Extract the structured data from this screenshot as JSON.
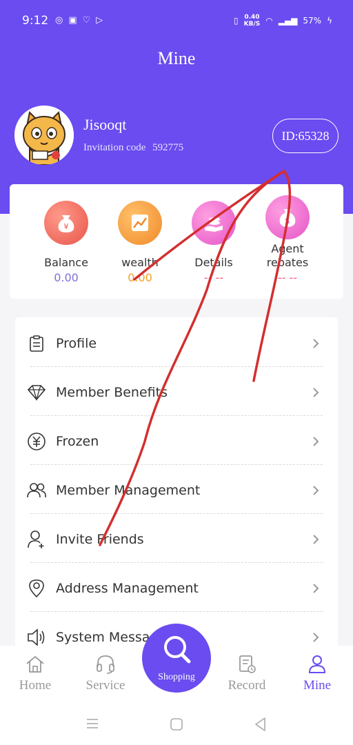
{
  "status_bar": {
    "time": "9:12",
    "net_speed_value": "0.40",
    "net_speed_unit": "KB/S",
    "battery": "57%"
  },
  "header": {
    "title": "Mine",
    "username": "Jisooqt",
    "invitation_label": "Invitation code",
    "invitation_code": "592775",
    "id_label": "ID:65328"
  },
  "stats": [
    {
      "label": "Balance",
      "value": "0.00",
      "color": "#7d6fd9",
      "icon": "money-bag-icon"
    },
    {
      "label": "wealth",
      "value": "0.00",
      "color": "#f0a020",
      "icon": "growth-chart-icon"
    },
    {
      "label": "Details",
      "value": "-- --",
      "color": "#f35c84",
      "icon": "hand-coin-icon"
    },
    {
      "label": "Agent\nrebates",
      "value": "-- --",
      "color": "#f35c84",
      "icon": "dollar-bag-icon"
    }
  ],
  "menu": [
    {
      "label": "Profile",
      "icon": "clipboard-icon"
    },
    {
      "label": "Member Benefits",
      "icon": "diamond-icon"
    },
    {
      "label": "Frozen",
      "icon": "yuan-circle-icon"
    },
    {
      "label": "Member Management",
      "icon": "users-icon"
    },
    {
      "label": "Invite Friends",
      "icon": "add-user-icon"
    },
    {
      "label": "Address Management",
      "icon": "location-pin-icon"
    },
    {
      "label": "System Messages",
      "icon": "speaker-icon"
    }
  ],
  "tabs": {
    "home": "Home",
    "service": "Service",
    "shopping": "Shopping",
    "record": "Record",
    "mine": "Mine"
  },
  "colors": {
    "primary": "#6a4cf0",
    "annotation": "#d32f2f"
  }
}
